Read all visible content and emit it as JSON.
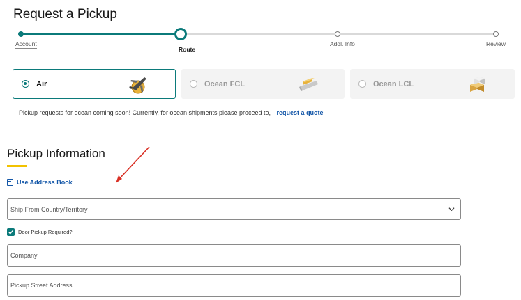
{
  "page": {
    "title": "Request a Pickup"
  },
  "stepper": {
    "steps": [
      {
        "label": "Account",
        "state": "done"
      },
      {
        "label": "Route",
        "state": "current"
      },
      {
        "label": "Addl. Info",
        "state": "todo"
      },
      {
        "label": "Review",
        "state": "todo"
      }
    ],
    "accent": "#0b7a7a"
  },
  "modes": [
    {
      "label": "Air",
      "selected": true,
      "icon": "airplane-icon"
    },
    {
      "label": "Ocean FCL",
      "selected": false,
      "icon": "ship-icon"
    },
    {
      "label": "Ocean LCL",
      "selected": false,
      "icon": "boxes-icon"
    }
  ],
  "ocean_note": {
    "text": "Pickup requests for ocean coming soon! Currently, for ocean shipments please proceed to,",
    "link": "request a quote"
  },
  "pickup_info": {
    "title": "Pickup Information",
    "address_book": "Use Address Book",
    "country_placeholder": "Ship From Country/Territory",
    "door_pickup": {
      "label": "Door Pickup Required?",
      "checked": true
    },
    "company_placeholder": "Company",
    "street_placeholder": "Pickup Street Address"
  },
  "colors": {
    "accent": "#0b7a7a",
    "link": "#1457a8",
    "underline": "#f2c200",
    "annotation": "#d93025"
  }
}
